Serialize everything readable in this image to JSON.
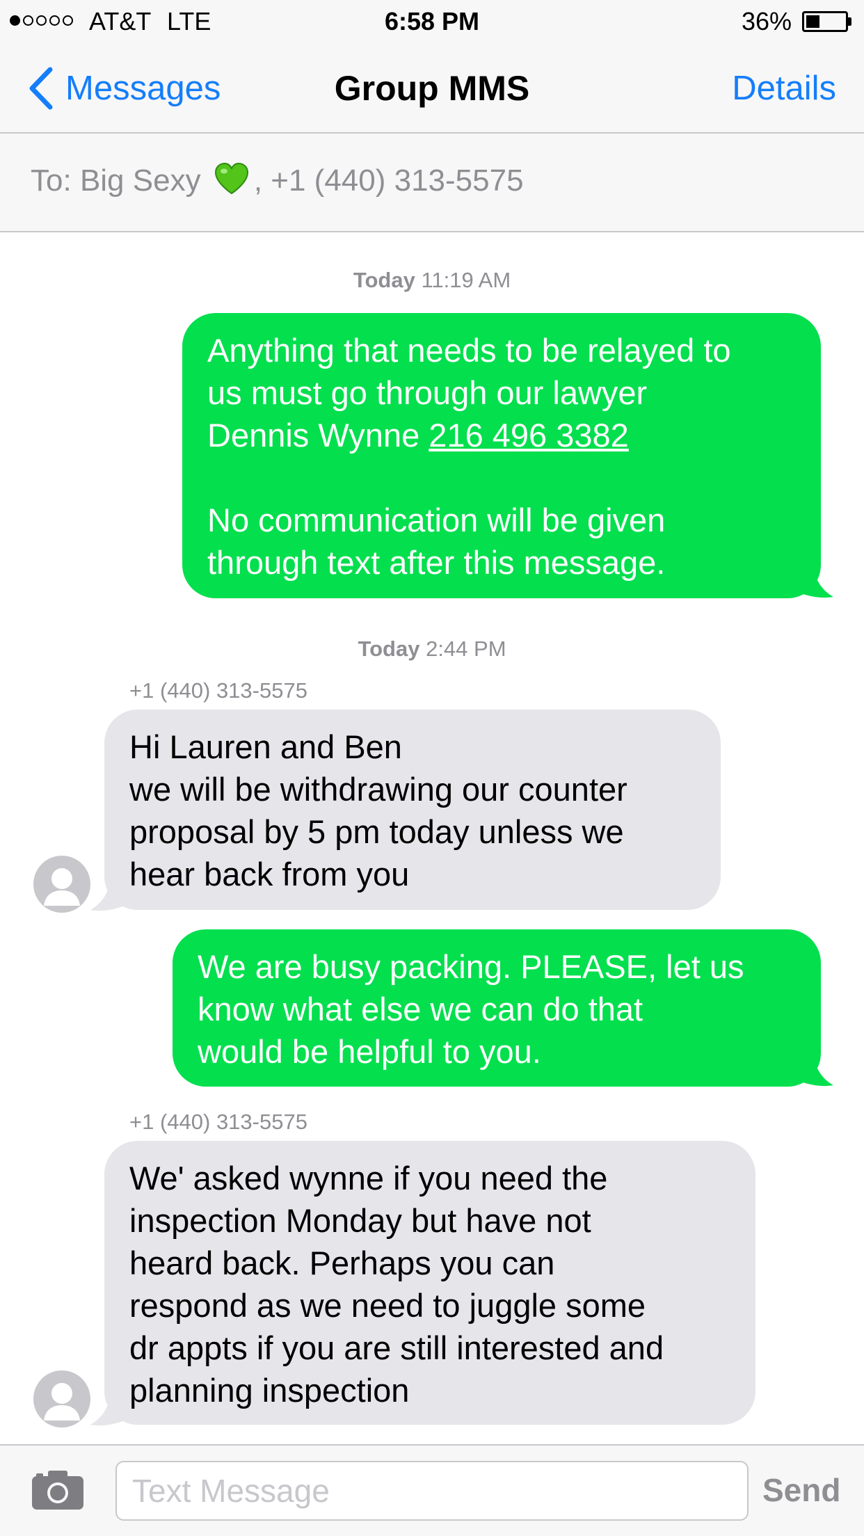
{
  "status_bar": {
    "signal_dots_filled": 1,
    "signal_dots_total": 5,
    "carrier": "AT&T",
    "network": "LTE",
    "time": "6:58 PM",
    "battery_percent_label": "36%",
    "battery_level": 0.36
  },
  "nav": {
    "back_label": "Messages",
    "title": "Group MMS",
    "details_label": "Details"
  },
  "to_field": {
    "label": "To:",
    "recipient_1": "Big Sexy",
    "recipient_1_emoji": "green-heart-icon",
    "separator": ",",
    "recipient_2": "+1 (440) 313-5575"
  },
  "conversation": {
    "timestamp_1": {
      "day": "Today",
      "time": "11:19 AM"
    },
    "message_1": {
      "direction": "outgoing",
      "text_before_link": "Anything that needs to be relayed to\nus must go through our lawyer\nDennis Wynne ",
      "link": "216 496 3382",
      "text_after_link": "\n\nNo communication will be given\nthrough text after this message."
    },
    "timestamp_2": {
      "day": "Today",
      "time": "2:44 PM"
    },
    "message_2": {
      "direction": "incoming",
      "sender": "+1 (440) 313-5575",
      "text": "Hi Lauren and Ben\nwe will be withdrawing our counter\nproposal by 5 pm today unless we\nhear back from you"
    },
    "message_3": {
      "direction": "outgoing",
      "text": "We are busy packing. PLEASE, let us\nknow what else we can do that\nwould be helpful to you."
    },
    "message_4": {
      "direction": "incoming",
      "sender": "+1 (440) 313-5575",
      "text": "We' asked wynne if you need the\ninspection Monday but have not\nheard back.  Perhaps you can\nrespond as we need to juggle some\ndr appts if you are still interested and\nplanning inspection"
    }
  },
  "input_bar": {
    "camera_icon": "camera-icon",
    "placeholder": "Text Message",
    "send_label": "Send"
  },
  "colors": {
    "ios_blue": "#147efb",
    "outgoing_bubble": "#04df4e",
    "incoming_bubble": "#e5e5ea",
    "meta_gray": "#8e8e93"
  }
}
